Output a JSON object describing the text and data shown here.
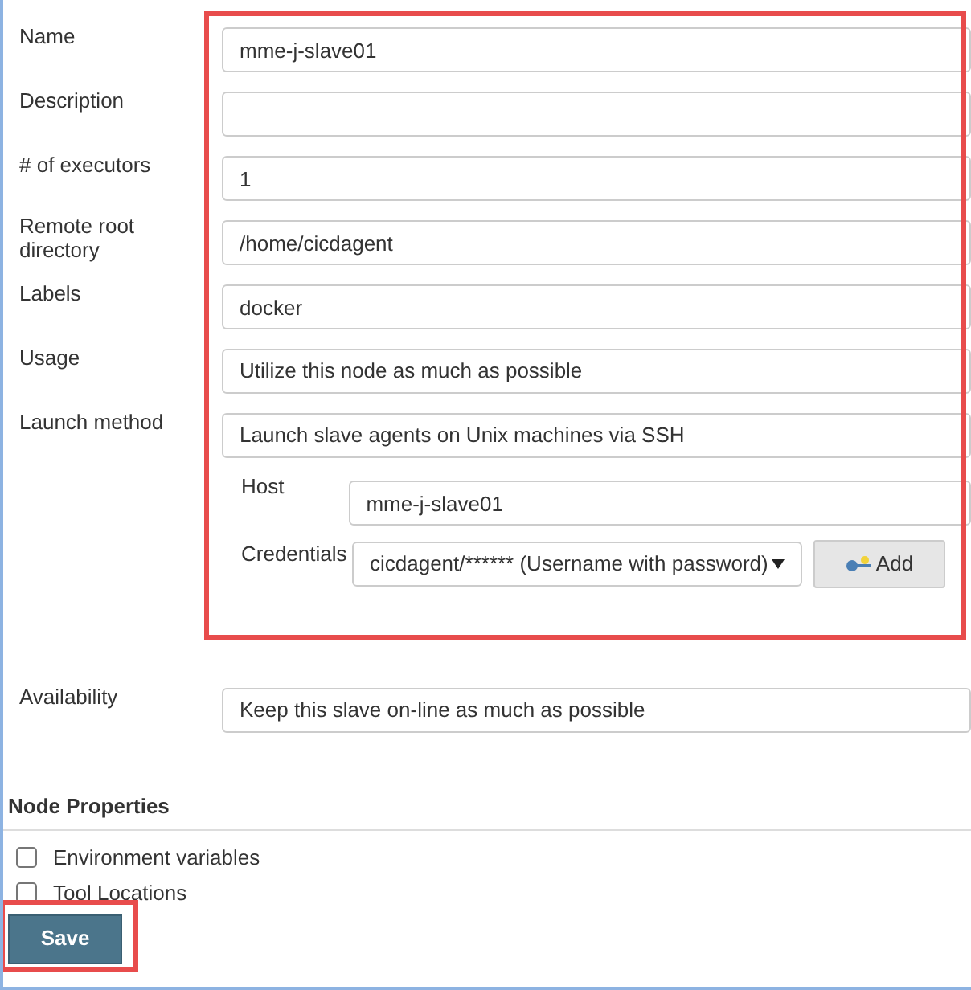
{
  "fields": [
    {
      "label": "Name",
      "kind": "text",
      "value": "mme-j-slave01"
    },
    {
      "label": "Description",
      "kind": "text"
    },
    {
      "label": "# of executors",
      "kind": "text",
      "value": "1"
    },
    {
      "label": "Remote root directory",
      "kind": "text",
      "value": "/home/cicdagent"
    },
    {
      "label": "Labels",
      "kind": "text",
      "value": "docker"
    },
    {
      "label": "Usage",
      "kind": "select",
      "value": "Utilize this node as much as possible"
    },
    {
      "label": "Launch method",
      "kind": "select",
      "value": "Launch slave agents on Unix machines via SSH"
    }
  ],
  "launch": {
    "host_label": "Host",
    "host": "mme-j-slave01",
    "credentials_label": "Credentials",
    "credentials": "cicdagent/****** (Username with password)",
    "add_button": "Add"
  },
  "availability": {
    "label": "Availability",
    "value": "Keep this slave on-line as much as possible"
  },
  "node_properties": {
    "title": "Node Properties",
    "items": [
      {
        "label": "Environment variables",
        "checked": false
      },
      {
        "label": "Tool Locations",
        "checked": false
      }
    ]
  },
  "save_button": "Save"
}
